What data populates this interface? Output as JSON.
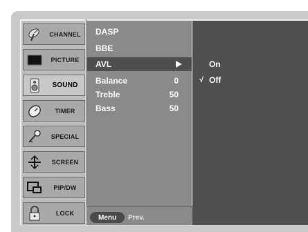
{
  "categories": [
    {
      "label": "CHANNEL",
      "icon": "satellite-dish-icon",
      "selected": false
    },
    {
      "label": "PICTURE",
      "icon": "tv-screen-icon",
      "selected": false
    },
    {
      "label": "SOUND",
      "icon": "speaker-icon",
      "selected": true
    },
    {
      "label": "TIMER",
      "icon": "timer-icon",
      "selected": false
    },
    {
      "label": "SPECIAL",
      "icon": "key-icon",
      "selected": false
    },
    {
      "label": "SCREEN",
      "icon": "screen-adjust-icon",
      "selected": false
    },
    {
      "label": "PIP/DW",
      "icon": "pip-icon",
      "selected": false
    },
    {
      "label": "LOCK",
      "icon": "padlock-icon",
      "selected": false
    }
  ],
  "items": [
    {
      "name": "DASP",
      "value": ""
    },
    {
      "name": "BBE",
      "value": ""
    },
    {
      "name": "AVL",
      "value": "",
      "highlighted": true
    },
    {
      "name": "Balance",
      "value": "0"
    },
    {
      "name": "Treble",
      "value": "50"
    },
    {
      "name": "Bass",
      "value": "50"
    }
  ],
  "options": [
    {
      "label": "On",
      "checked": false
    },
    {
      "label": "Off",
      "checked": true,
      "check_mark": "√"
    }
  ],
  "bottom_bar": {
    "menu_label": "Menu",
    "prev_label": "Prev."
  }
}
